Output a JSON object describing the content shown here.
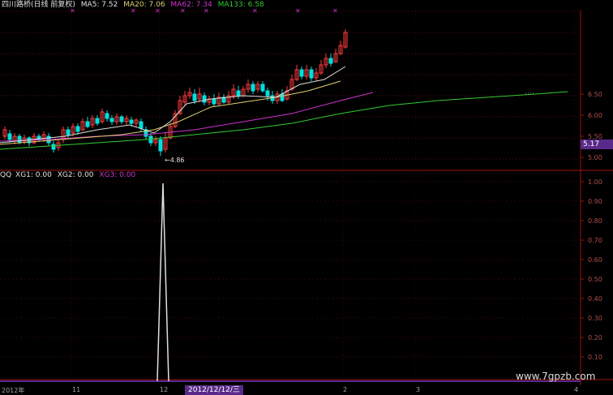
{
  "header": {
    "stock_label": "四川路桥(日线 前复权)",
    "ma5": "MA5: 7.52",
    "ma20": "MA20: 7.06",
    "ma62": "MA62: 7.34",
    "ma133": "MA133: 6.58"
  },
  "indicator_header": {
    "name": "QQ",
    "xg1": "XG1: 0.00",
    "xg2": "XG2: 0.00",
    "xg3": "XG3: 0.00"
  },
  "colors": {
    "up": "#ff3b3b",
    "down": "#00e0e0",
    "ma5": "#e0e0e0",
    "ma20": "#e0d070",
    "ma62": "#cc33cc",
    "ma133": "#33cc33",
    "axis": "#a01010",
    "tag": "#5a2a8a"
  },
  "price_axis": {
    "ticks": [
      "6.50",
      "6.00",
      "5.50",
      "5.00"
    ],
    "current_price": "5.17"
  },
  "indicator_axis": {
    "ticks": [
      "1.00",
      "0.90",
      "0.80",
      "0.70",
      "0.60",
      "0.50",
      "0.40",
      "0.30",
      "0.20",
      "0.10"
    ]
  },
  "low_marker": "4.86",
  "x_axis": {
    "labels": [
      "2012年",
      "11",
      "12",
      "2",
      "3",
      "4"
    ],
    "crosshair_date": "2012/12/12/三"
  },
  "watermark": "www.7gpzb.com",
  "chart_data": {
    "type": "candlestick",
    "ma_series_names": [
      "MA5",
      "MA20",
      "MA62",
      "MA133"
    ],
    "signal_spike": {
      "date": "2012/12/12",
      "value": 1.0
    }
  }
}
